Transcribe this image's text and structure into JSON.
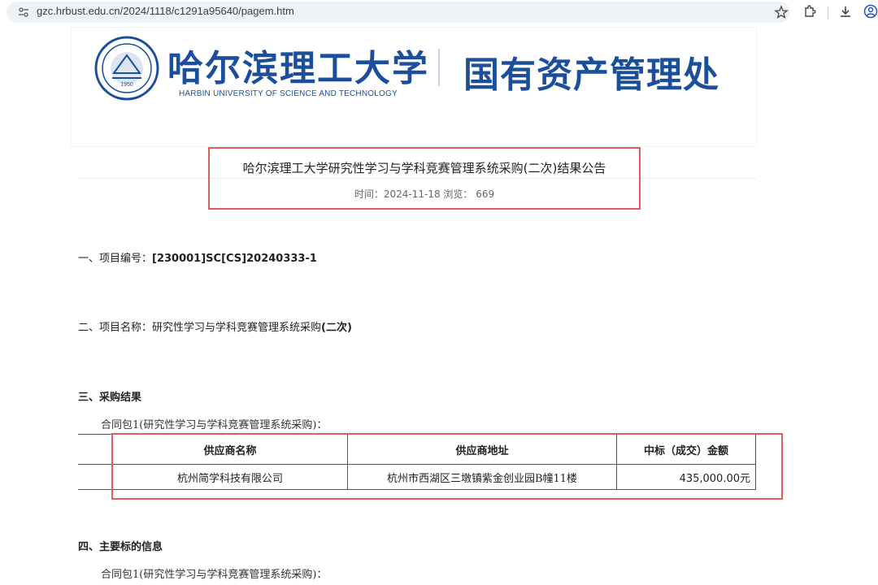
{
  "browser": {
    "url": "gzc.hrbust.edu.cn/2024/1118/c1291a95640/pagem.htm"
  },
  "header": {
    "university_cn": "哈尔滨理工大学",
    "university_en": "HARBIN UNIVERSITY OF SCIENCE AND TECHNOLOGY",
    "department": "国有资产管理处",
    "brand_color": "#1b4f9c"
  },
  "article": {
    "title": "哈尔滨理工大学研究性学习与学科竞赛管理系统采购(二次)结果公告",
    "meta": "时间：2024-11-18    浏览：  669"
  },
  "sections": {
    "s1_label": "一、项目编号：",
    "s1_value": "[230001]SC[CS]20240333-1",
    "s2_label": "二、项目名称：研究性学习与学科竞赛管理系统采购",
    "s2_value": "(二次)",
    "s3_heading": "三、采购结果",
    "s3_sub": "合同包1(研究性学习与学科竞赛管理系统采购)：",
    "s4_heading": "四、主要标的信息",
    "s4_sub": "合同包1(研究性学习与学科竞赛管理系统采购)："
  },
  "result_table": {
    "headers": [
      "供应商名称",
      "供应商地址",
      "中标（成交）金额"
    ],
    "rows": [
      [
        "杭州简学科技有限公司",
        "杭州市西湖区三墩镇紫金创业园B幢11楼",
        "435,000.00元"
      ]
    ]
  },
  "highlight_color": "#e35b5b"
}
